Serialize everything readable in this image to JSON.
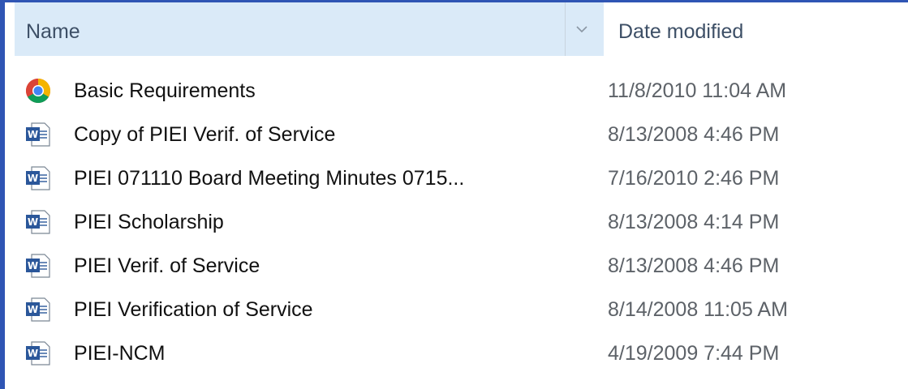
{
  "columns": {
    "name": "Name",
    "date_modified": "Date modified"
  },
  "files": [
    {
      "icon": "chrome-icon",
      "name": "Basic Requirements",
      "date": "11/8/2010 11:04 AM"
    },
    {
      "icon": "word-document-icon",
      "name": "Copy of PIEI Verif. of Service",
      "date": "8/13/2008 4:46 PM"
    },
    {
      "icon": "word-document-icon",
      "name": "PIEI 071110 Board Meeting Minutes 0715...",
      "date": "7/16/2010 2:46 PM"
    },
    {
      "icon": "word-document-icon",
      "name": "PIEI Scholarship",
      "date": "8/13/2008 4:14 PM"
    },
    {
      "icon": "word-document-icon",
      "name": "PIEI Verif. of Service",
      "date": "8/13/2008 4:46 PM"
    },
    {
      "icon": "word-document-icon",
      "name": "PIEI Verification of Service",
      "date": "8/14/2008 11:05 AM"
    },
    {
      "icon": "word-document-icon",
      "name": "PIEI-NCM",
      "date": "4/19/2009 7:44 PM"
    }
  ],
  "colors": {
    "frame_border": "#2f55b4",
    "header_highlight": "#daeaf8",
    "word_blue": "#2b579a"
  }
}
